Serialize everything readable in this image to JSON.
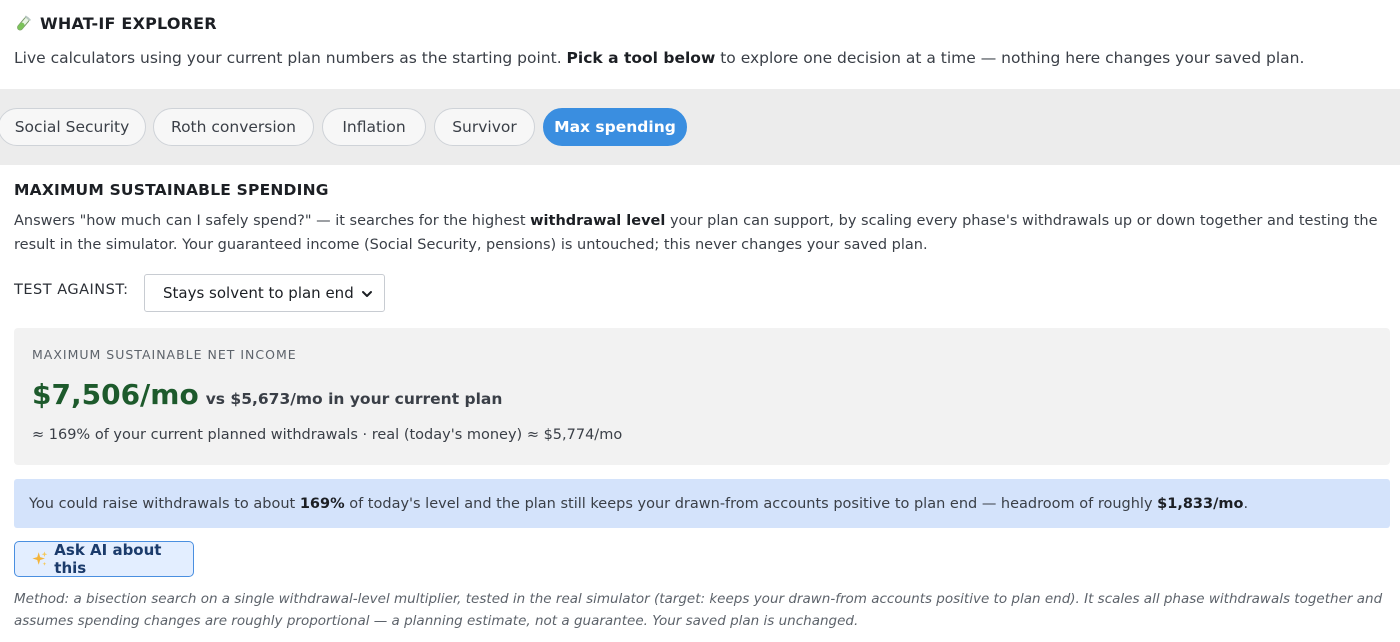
{
  "header": {
    "icon": "test-tube-icon",
    "title": "WHAT-IF EXPLORER",
    "intro_pre": "Live calculators using your current plan numbers as the starting point. ",
    "intro_bold": "Pick a tool below",
    "intro_post": " to explore one decision at a time — nothing here changes your saved plan."
  },
  "tabs": [
    {
      "label": "Social Security",
      "active": false
    },
    {
      "label": "Roth conversion",
      "active": false
    },
    {
      "label": "Inflation",
      "active": false
    },
    {
      "label": "Survivor",
      "active": false
    },
    {
      "label": "Max spending",
      "active": true
    }
  ],
  "section": {
    "title": "MAXIMUM SUSTAINABLE SPENDING",
    "desc_pre": "Answers \"how much can I safely spend?\" — it searches for the highest ",
    "desc_bold": "withdrawal level",
    "desc_post": " your plan can support, by scaling every phase's withdrawals up or down together and testing the result in the simulator. Your guaranteed income (Social Security, pensions) is untouched; this never changes your saved plan.",
    "test_label": "TEST AGAINST:",
    "test_value": "Stays solvent to plan end"
  },
  "result": {
    "kicker": "MAXIMUM SUSTAINABLE NET INCOME",
    "amount": "$7,506/mo",
    "compare": "vs $5,673/mo in your current plan",
    "sub": "≈ 169% of your current planned withdrawals · real (today's money) ≈ $5,774/mo"
  },
  "note": {
    "pre": "You could raise withdrawals to about ",
    "pct": "169%",
    "mid": " of today's level and the plan still keeps your drawn-from accounts positive to plan end — headroom of roughly ",
    "headroom": "$1,833/mo",
    "end": "."
  },
  "ask_button": {
    "icon": "sparkles-icon",
    "label": "Ask AI about this"
  },
  "method": "Method: a bisection search on a single withdrawal-level multiplier, tested in the real simulator (target: keeps your drawn-from accounts positive to plan end). It scales all phase withdrawals together and assumes spending changes are roughly proportional — a planning estimate, not a guarantee. Your saved plan is unchanged.",
  "colors": {
    "accent": "#3a8ee0",
    "positive": "#1d5a2c",
    "note_bg": "#d4e3fb"
  }
}
